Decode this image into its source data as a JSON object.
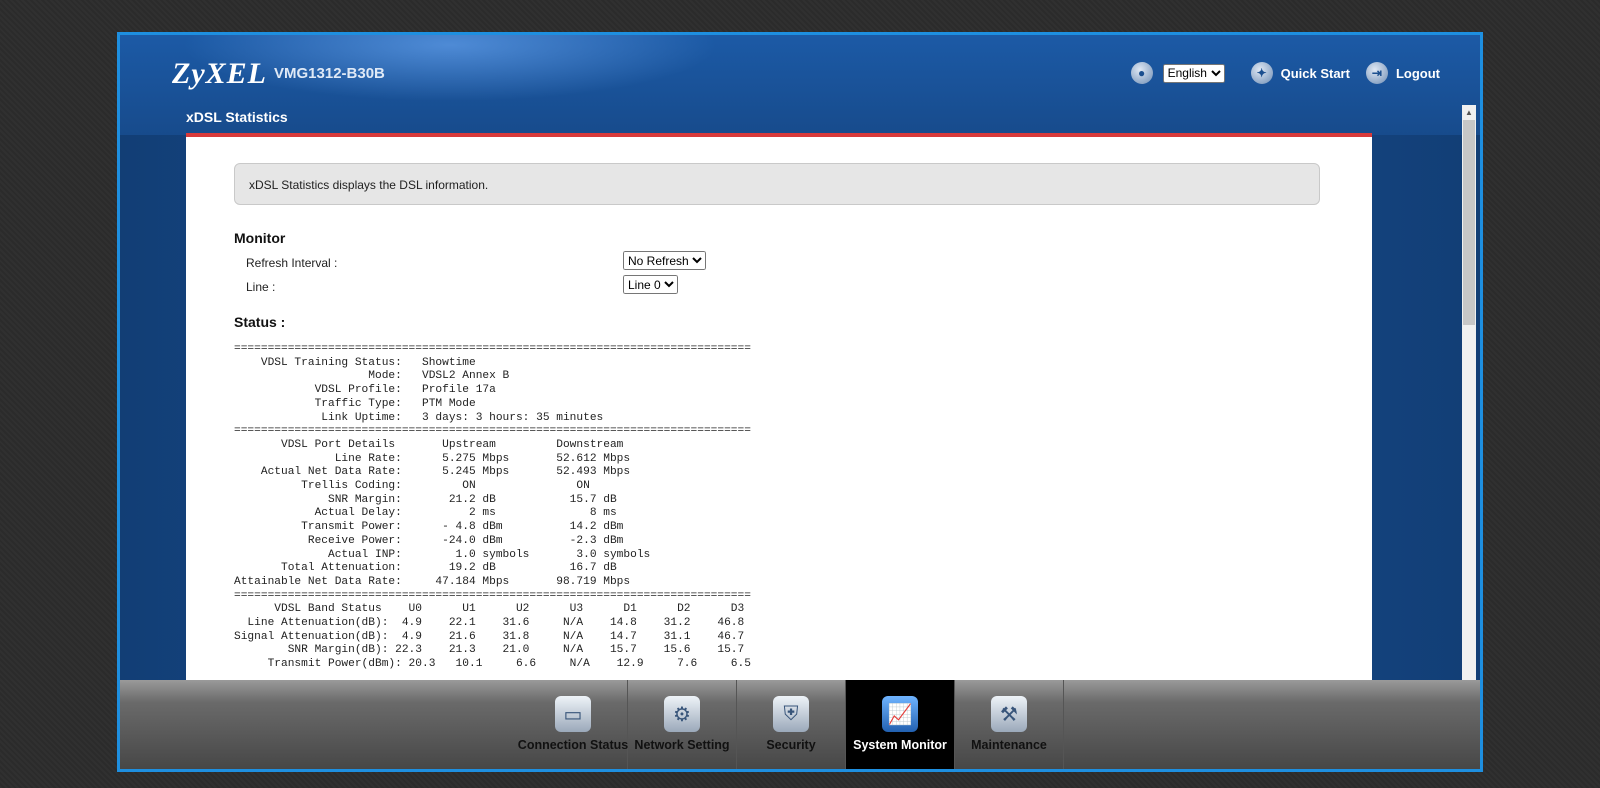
{
  "header": {
    "brand": "ZyXEL",
    "model": "VMG1312-B30B",
    "language": {
      "selected": "English",
      "icon": "language-icon"
    },
    "quick_start": {
      "label": "Quick Start",
      "icon": "wand-icon"
    },
    "logout": {
      "label": "Logout",
      "icon": "logout-icon"
    }
  },
  "page": {
    "title": "xDSL Statistics",
    "info": "xDSL Statistics displays the DSL information."
  },
  "monitor": {
    "heading": "Monitor",
    "refresh_label": "Refresh Interval :",
    "refresh_value": "No Refresh",
    "line_label": "Line :",
    "line_value": "Line 0"
  },
  "status": {
    "heading": "Status :",
    "text": "=============================================================================\n    VDSL Training Status:   Showtime\n                    Mode:   VDSL2 Annex B\n            VDSL Profile:   Profile 17a\n            Traffic Type:   PTM Mode\n             Link Uptime:   3 days: 3 hours: 35 minutes\n=============================================================================\n       VDSL Port Details       Upstream         Downstream\n               Line Rate:      5.275 Mbps       52.612 Mbps\n    Actual Net Data Rate:      5.245 Mbps       52.493 Mbps\n          Trellis Coding:         ON               ON\n              SNR Margin:       21.2 dB           15.7 dB\n            Actual Delay:          2 ms              8 ms\n          Transmit Power:      - 4.8 dBm          14.2 dBm\n           Receive Power:      -24.0 dBm          -2.3 dBm\n              Actual INP:        1.0 symbols       3.0 symbols\n       Total Attenuation:       19.2 dB           16.7 dB\nAttainable Net Data Rate:     47.184 Mbps       98.719 Mbps\n=============================================================================\n      VDSL Band Status    U0      U1      U2      U3      D1      D2      D3\n  Line Attenuation(dB):  4.9    22.1    31.6     N/A    14.8    31.2    46.8\nSignal Attenuation(dB):  4.9    21.6    31.8     N/A    14.7    31.1    46.7\n        SNR Margin(dB): 22.3    21.3    21.0     N/A    15.7    15.6    15.7\n     Transmit Power(dBm): 20.3   10.1     6.6     N/A    12.9     7.6     6.5"
  },
  "nav": [
    {
      "label": "Connection Status",
      "icon": "connection-status-icon",
      "glyph": "▭",
      "active": false
    },
    {
      "label": "Network Setting",
      "icon": "gear-icon",
      "glyph": "⚙",
      "active": false
    },
    {
      "label": "Security",
      "icon": "shield-icon",
      "glyph": "⛨",
      "active": false
    },
    {
      "label": "System Monitor",
      "icon": "chart-icon",
      "glyph": "📈",
      "active": true
    },
    {
      "label": "Maintenance",
      "icon": "tools-icon",
      "glyph": "⚒",
      "active": false
    }
  ],
  "colors": {
    "accent_red": "#d83a3a",
    "frame_blue": "#1e8fe0",
    "active_nav": "#000000"
  }
}
